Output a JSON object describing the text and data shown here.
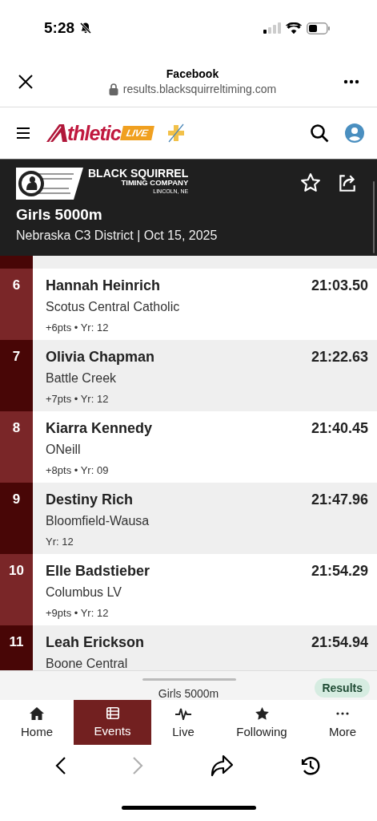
{
  "status_bar": {
    "time": "5:28"
  },
  "browser": {
    "title": "Facebook",
    "url": "results.blacksquirreltiming.com"
  },
  "app_header": {
    "logo_word": "thletic",
    "logo_badge": "LIVE"
  },
  "event": {
    "org_name": "BLACK SQUIRREL",
    "org_sub": "TIMING COMPANY",
    "org_city": "LINCOLN, NE",
    "title": "Girls 5000m",
    "meet": "Nebraska C3 District | Oct 15, 2025"
  },
  "results": [
    {
      "place": "6",
      "name": "Hannah Heinrich",
      "time": "21:03.50",
      "school": "Scotus Central Catholic",
      "stats": "+6pts • Yr: 12"
    },
    {
      "place": "7",
      "name": "Olivia Chapman",
      "time": "21:22.63",
      "school": "Battle Creek",
      "stats": "+7pts • Yr: 12"
    },
    {
      "place": "8",
      "name": "Kiarra Kennedy",
      "time": "21:40.45",
      "school": "ONeill",
      "stats": "+8pts • Yr: 09"
    },
    {
      "place": "9",
      "name": "Destiny Rich",
      "time": "21:47.96",
      "school": "Bloomfield-Wausa",
      "stats": "Yr: 12"
    },
    {
      "place": "10",
      "name": "Elle Badstieber",
      "time": "21:54.29",
      "school": "Columbus LV",
      "stats": "+9pts • Yr: 12"
    },
    {
      "place": "11",
      "name": "Leah Erickson",
      "time": "21:54.94",
      "school": "Boone Central"
    }
  ],
  "sheet": {
    "title": "Girls 5000m",
    "badge": "Results"
  },
  "tabs": [
    {
      "label": "Home",
      "kind": "home",
      "selected": false
    },
    {
      "label": "Events",
      "kind": "events",
      "selected": true
    },
    {
      "label": "Live",
      "kind": "live",
      "selected": false
    },
    {
      "label": "Following",
      "kind": "following",
      "selected": false
    },
    {
      "label": "More",
      "kind": "more",
      "selected": false
    }
  ],
  "toolbar": {
    "forward_disabled": true
  }
}
